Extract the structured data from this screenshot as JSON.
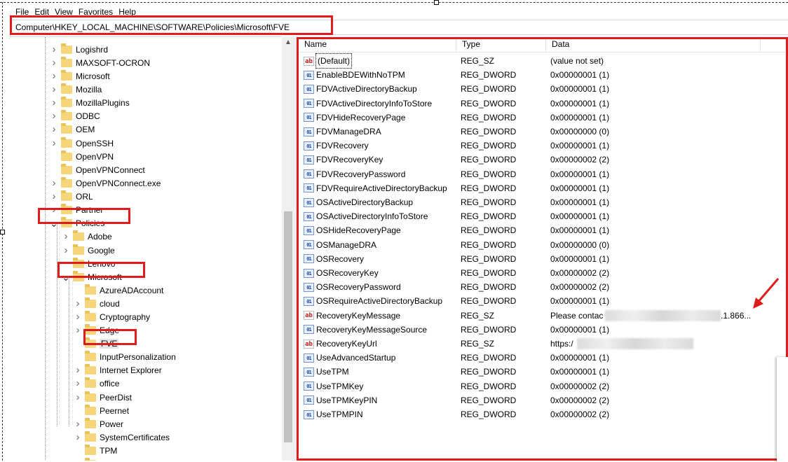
{
  "menu": [
    "File",
    "Edit",
    "View",
    "Favorites",
    "Help"
  ],
  "address": "Computer\\HKEY_LOCAL_MACHINE\\SOFTWARE\\Policies\\Microsoft\\FVE",
  "tree": [
    {
      "label": "Logishrd",
      "expandable": true
    },
    {
      "label": "MAXSOFT-OCRON",
      "expandable": true
    },
    {
      "label": "Microsoft",
      "expandable": true
    },
    {
      "label": "Mozilla",
      "expandable": true
    },
    {
      "label": "MozillaPlugins",
      "expandable": true
    },
    {
      "label": "ODBC",
      "expandable": true
    },
    {
      "label": "OEM",
      "expandable": true
    },
    {
      "label": "OpenSSH",
      "expandable": true
    },
    {
      "label": "OpenVPN",
      "expandable": false
    },
    {
      "label": "OpenVPNConnect",
      "expandable": false
    },
    {
      "label": "OpenVPNConnect.exe",
      "expandable": true
    },
    {
      "label": "ORL",
      "expandable": true
    },
    {
      "label": "Partner",
      "expandable": true
    },
    {
      "label": "Policies",
      "expandable": true,
      "expanded": true
    },
    {
      "label": "Adobe",
      "expandable": true
    },
    {
      "label": "Google",
      "expandable": true
    },
    {
      "label": "Lenovo",
      "expandable": false
    },
    {
      "label": "Microsoft",
      "expandable": true,
      "expanded": true
    },
    {
      "label": "AzureADAccount",
      "expandable": false
    },
    {
      "label": "cloud",
      "expandable": true
    },
    {
      "label": "Cryptography",
      "expandable": true
    },
    {
      "label": "Edge",
      "expandable": true
    },
    {
      "label": "FVE",
      "expandable": false,
      "selected": true
    },
    {
      "label": "InputPersonalization",
      "expandable": false
    },
    {
      "label": "Internet Explorer",
      "expandable": true
    },
    {
      "label": "office",
      "expandable": true
    },
    {
      "label": "PeerDist",
      "expandable": true
    },
    {
      "label": "Peernet",
      "expandable": false
    },
    {
      "label": "Power",
      "expandable": true
    },
    {
      "label": "SystemCertificates",
      "expandable": true
    },
    {
      "label": "TPM",
      "expandable": false
    },
    {
      "label": "Windows",
      "expandable": true
    }
  ],
  "columns": {
    "name": "Name",
    "type": "Type",
    "data": "Data"
  },
  "values": [
    {
      "name": "(Default)",
      "type": "REG_SZ",
      "data": "(value not set)"
    },
    {
      "name": "EnableBDEWithNoTPM",
      "type": "REG_DWORD",
      "data": "0x00000001 (1)"
    },
    {
      "name": "FDVActiveDirectoryBackup",
      "type": "REG_DWORD",
      "data": "0x00000001 (1)"
    },
    {
      "name": "FDVActiveDirectoryInfoToStore",
      "type": "REG_DWORD",
      "data": "0x00000001 (1)"
    },
    {
      "name": "FDVHideRecoveryPage",
      "type": "REG_DWORD",
      "data": "0x00000001 (1)"
    },
    {
      "name": "FDVManageDRA",
      "type": "REG_DWORD",
      "data": "0x00000000 (0)"
    },
    {
      "name": "FDVRecovery",
      "type": "REG_DWORD",
      "data": "0x00000001 (1)"
    },
    {
      "name": "FDVRecoveryKey",
      "type": "REG_DWORD",
      "data": "0x00000002 (2)"
    },
    {
      "name": "FDVRecoveryPassword",
      "type": "REG_DWORD",
      "data": "0x00000001 (1)"
    },
    {
      "name": "FDVRequireActiveDirectoryBackup",
      "type": "REG_DWORD",
      "data": "0x00000001 (1)"
    },
    {
      "name": "OSActiveDirectoryBackup",
      "type": "REG_DWORD",
      "data": "0x00000001 (1)"
    },
    {
      "name": "OSActiveDirectoryInfoToStore",
      "type": "REG_DWORD",
      "data": "0x00000001 (1)"
    },
    {
      "name": "OSHideRecoveryPage",
      "type": "REG_DWORD",
      "data": "0x00000001 (1)"
    },
    {
      "name": "OSManageDRA",
      "type": "REG_DWORD",
      "data": "0x00000000 (0)"
    },
    {
      "name": "OSRecovery",
      "type": "REG_DWORD",
      "data": "0x00000001 (1)"
    },
    {
      "name": "OSRecoveryKey",
      "type": "REG_DWORD",
      "data": "0x00000002 (2)"
    },
    {
      "name": "OSRecoveryPassword",
      "type": "REG_DWORD",
      "data": "0x00000002 (2)"
    },
    {
      "name": "OSRequireActiveDirectoryBackup",
      "type": "REG_DWORD",
      "data": "0x00000001 (1)"
    },
    {
      "name": "RecoveryKeyMessage",
      "type": "REG_SZ",
      "data": "Please contac",
      "data_suffix": ".1.866..."
    },
    {
      "name": "RecoveryKeyMessageSource",
      "type": "REG_DWORD",
      "data": "0x00000001 (1)"
    },
    {
      "name": "RecoveryKeyUrl",
      "type": "REG_SZ",
      "data": "https:/"
    },
    {
      "name": "UseAdvancedStartup",
      "type": "REG_DWORD",
      "data": "0x00000001 (1)"
    },
    {
      "name": "UseTPM",
      "type": "REG_DWORD",
      "data": "0x00000001 (1)"
    },
    {
      "name": "UseTPMKey",
      "type": "REG_DWORD",
      "data": "0x00000002 (2)"
    },
    {
      "name": "UseTPMKeyPIN",
      "type": "REG_DWORD",
      "data": "0x00000002 (2)"
    },
    {
      "name": "UseTPMPIN",
      "type": "REG_DWORD",
      "data": "0x00000002 (2)"
    }
  ],
  "icons": {
    "string": "ab",
    "dword": "011\n110"
  },
  "colors": {
    "highlight": "#e01b1b",
    "folder": "#f5d67a"
  }
}
